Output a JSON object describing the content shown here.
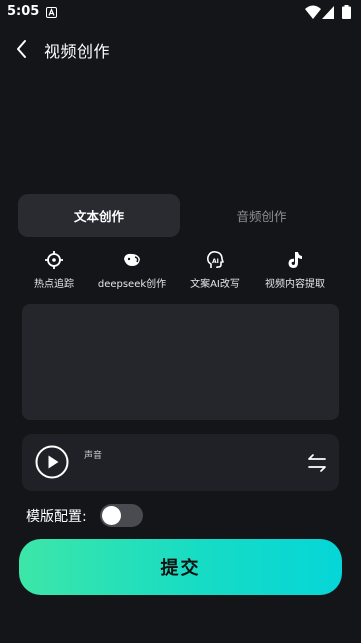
{
  "status_bar": {
    "time": "5:05"
  },
  "header": {
    "title": "视频创作"
  },
  "tabs": [
    {
      "label": "文本创作",
      "active": true
    },
    {
      "label": "音频创作",
      "active": false
    }
  ],
  "tools": [
    {
      "label": "热点追踪",
      "icon": "crosshair-icon"
    },
    {
      "label": "deepseek创作",
      "icon": "deepseek-whale-icon"
    },
    {
      "label": "文案AI改写",
      "icon": "ai-head-icon"
    },
    {
      "label": "视频内容提取",
      "icon": "tiktok-icon"
    }
  ],
  "text_area": {
    "value": ""
  },
  "voice": {
    "label": "声音"
  },
  "template": {
    "label": "模版配置:",
    "enabled": false
  },
  "submit": {
    "label": "提交"
  },
  "colors": {
    "background": "#141519",
    "tab_active": "#2a2b31",
    "panel": "#25262b",
    "voice_card": "#202126",
    "submit_gradient_start": "#3de6a8",
    "submit_gradient_end": "#06d6d8",
    "toggle_off": "#4a4b51"
  }
}
